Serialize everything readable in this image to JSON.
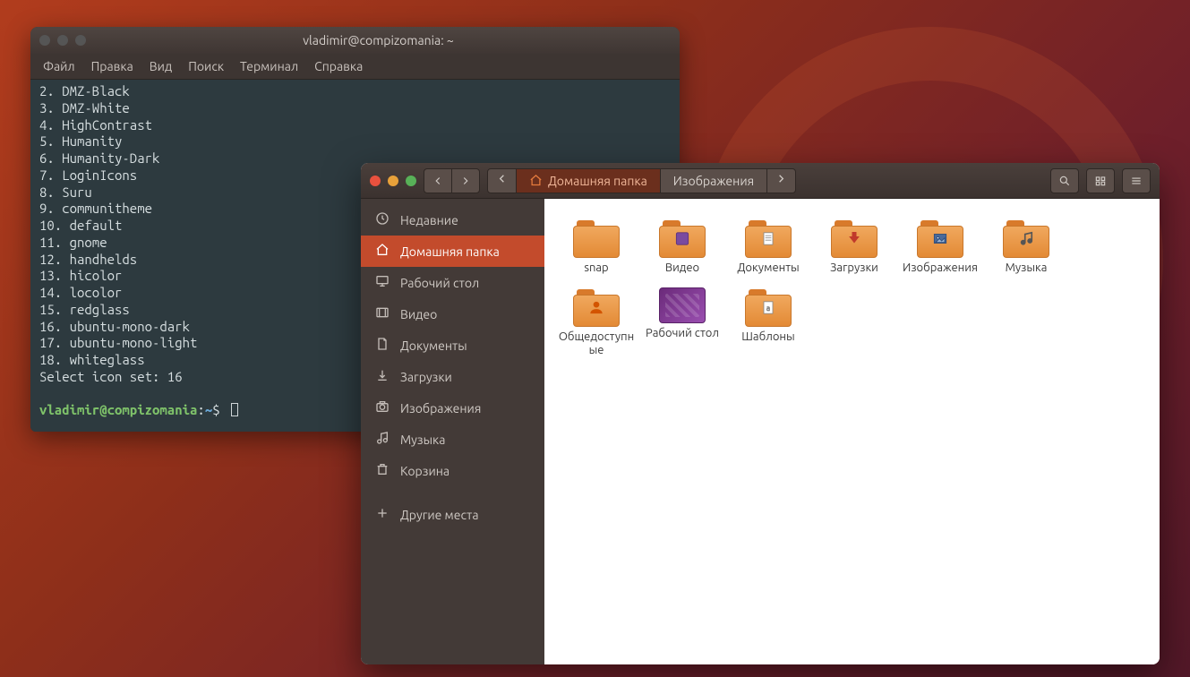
{
  "terminal": {
    "title": "vladimir@compizomania: ~",
    "menus": [
      "Файл",
      "Правка",
      "Вид",
      "Поиск",
      "Терминал",
      "Справка"
    ],
    "lines": [
      "2. DMZ-Black",
      "3. DMZ-White",
      "4. HighContrast",
      "5. Humanity",
      "6. Humanity-Dark",
      "7. LoginIcons",
      "8. Suru",
      "9. communitheme",
      "10. default",
      "11. gnome",
      "12. handhelds",
      "13. hicolor",
      "14. locolor",
      "15. redglass",
      "16. ubuntu-mono-dark",
      "17. ubuntu-mono-light",
      "18. whiteglass",
      "Select icon set: 16",
      ""
    ],
    "prompt_user": "vladimir@compizomania",
    "prompt_path": "~",
    "prompt_symbol": "$"
  },
  "files": {
    "path": {
      "home_label": "Домашняя папка",
      "current_label": "Изображения"
    },
    "sidebar": [
      {
        "label": "Недавние",
        "icon": "clock",
        "active": false
      },
      {
        "label": "Домашняя папка",
        "icon": "home",
        "active": true
      },
      {
        "label": "Рабочий стол",
        "icon": "desktop",
        "active": false
      },
      {
        "label": "Видео",
        "icon": "video",
        "active": false
      },
      {
        "label": "Документы",
        "icon": "document",
        "active": false
      },
      {
        "label": "Загрузки",
        "icon": "download",
        "active": false
      },
      {
        "label": "Изображения",
        "icon": "camera",
        "active": false
      },
      {
        "label": "Музыка",
        "icon": "music",
        "active": false
      },
      {
        "label": "Корзина",
        "icon": "trash",
        "active": false
      },
      {
        "label": "Другие места",
        "icon": "plus",
        "active": false
      }
    ],
    "items": [
      {
        "label": "snap",
        "type": "folder"
      },
      {
        "label": "Видео",
        "type": "folder-video"
      },
      {
        "label": "Документы",
        "type": "folder-doc"
      },
      {
        "label": "Загрузки",
        "type": "folder-download"
      },
      {
        "label": "Изображения",
        "type": "folder-image"
      },
      {
        "label": "Музыка",
        "type": "folder-music"
      },
      {
        "label": "Общедоступные",
        "type": "folder-public"
      },
      {
        "label": "Рабочий стол",
        "type": "desktop"
      },
      {
        "label": "Шаблоны",
        "type": "folder-template"
      }
    ]
  }
}
